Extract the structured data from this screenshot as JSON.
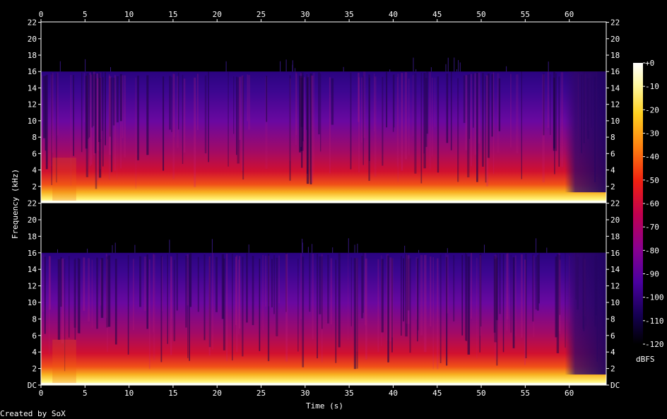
{
  "chart_data": {
    "type": "heatmap",
    "xlabel": "Time (s)",
    "ylabel": "Frequency (kHz)",
    "xlim": [
      0,
      64.2
    ],
    "ylim": [
      0,
      22.05
    ],
    "x_ticks": [
      "0",
      "5",
      "10",
      "15",
      "20",
      "25",
      "30",
      "35",
      "40",
      "45",
      "50",
      "55",
      "60"
    ],
    "x_tick_values": [
      0,
      5,
      10,
      15,
      20,
      25,
      30,
      35,
      40,
      45,
      50,
      55,
      60
    ],
    "y_ticks": [
      "DC",
      "2",
      "4",
      "6",
      "8",
      "10",
      "12",
      "14",
      "16",
      "18",
      "20",
      "22"
    ],
    "y_tick_values": [
      0,
      2,
      4,
      6,
      8,
      10,
      12,
      14,
      16,
      18,
      20,
      22
    ],
    "channel_top_label": "22",
    "channels": 2,
    "bandlimit_khz": 16,
    "fade_start_s": 59.5,
    "colorbar": {
      "label": "dBFS",
      "ticks": [
        "+0",
        "-10",
        "-20",
        "-30",
        "-40",
        "-50",
        "-60",
        "-70",
        "-80",
        "-90",
        "-100",
        "-110",
        "-120"
      ],
      "tick_values": [
        0,
        -10,
        -20,
        -30,
        -40,
        -50,
        -60,
        -70,
        -80,
        -90,
        -100,
        -110,
        -120
      ],
      "range": [
        -120,
        0
      ]
    },
    "grid": false
  },
  "footer": {
    "credit": "Created by SoX"
  }
}
